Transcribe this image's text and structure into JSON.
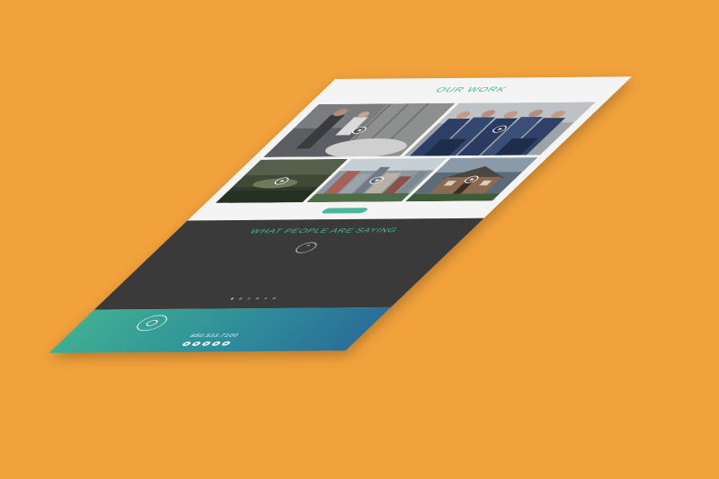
{
  "colors": {
    "background": "#f2a23c",
    "accent": "#49b79a",
    "dark_section": "#3a3a3a",
    "footer_start": "#3fae92",
    "footer_end": "#2a6f98"
  },
  "work": {
    "title": "OUR WORK",
    "subtitle": "",
    "view_more_label": "",
    "thumbnails": [
      {
        "name": "wedding-video",
        "icon": "play-icon"
      },
      {
        "name": "team-video",
        "icon": "play-icon"
      },
      {
        "name": "aerial-landscape-video",
        "icon": "play-icon"
      },
      {
        "name": "city-aerial-video",
        "icon": "play-icon"
      },
      {
        "name": "house-exterior-video",
        "icon": "play-icon"
      }
    ]
  },
  "testimonials": {
    "title": "WHAT PEOPLE ARE SAYING",
    "quote_icon": "quote-icon",
    "quote": "",
    "author": "",
    "slide_count": 6,
    "active_slide": 0
  },
  "footer": {
    "logo_icon": "brand-logo",
    "description": "",
    "phone": "850.533.7100",
    "social_icons": [
      "facebook-icon",
      "instagram-icon",
      "twitter-icon",
      "vimeo-icon",
      "youtube-icon"
    ]
  }
}
